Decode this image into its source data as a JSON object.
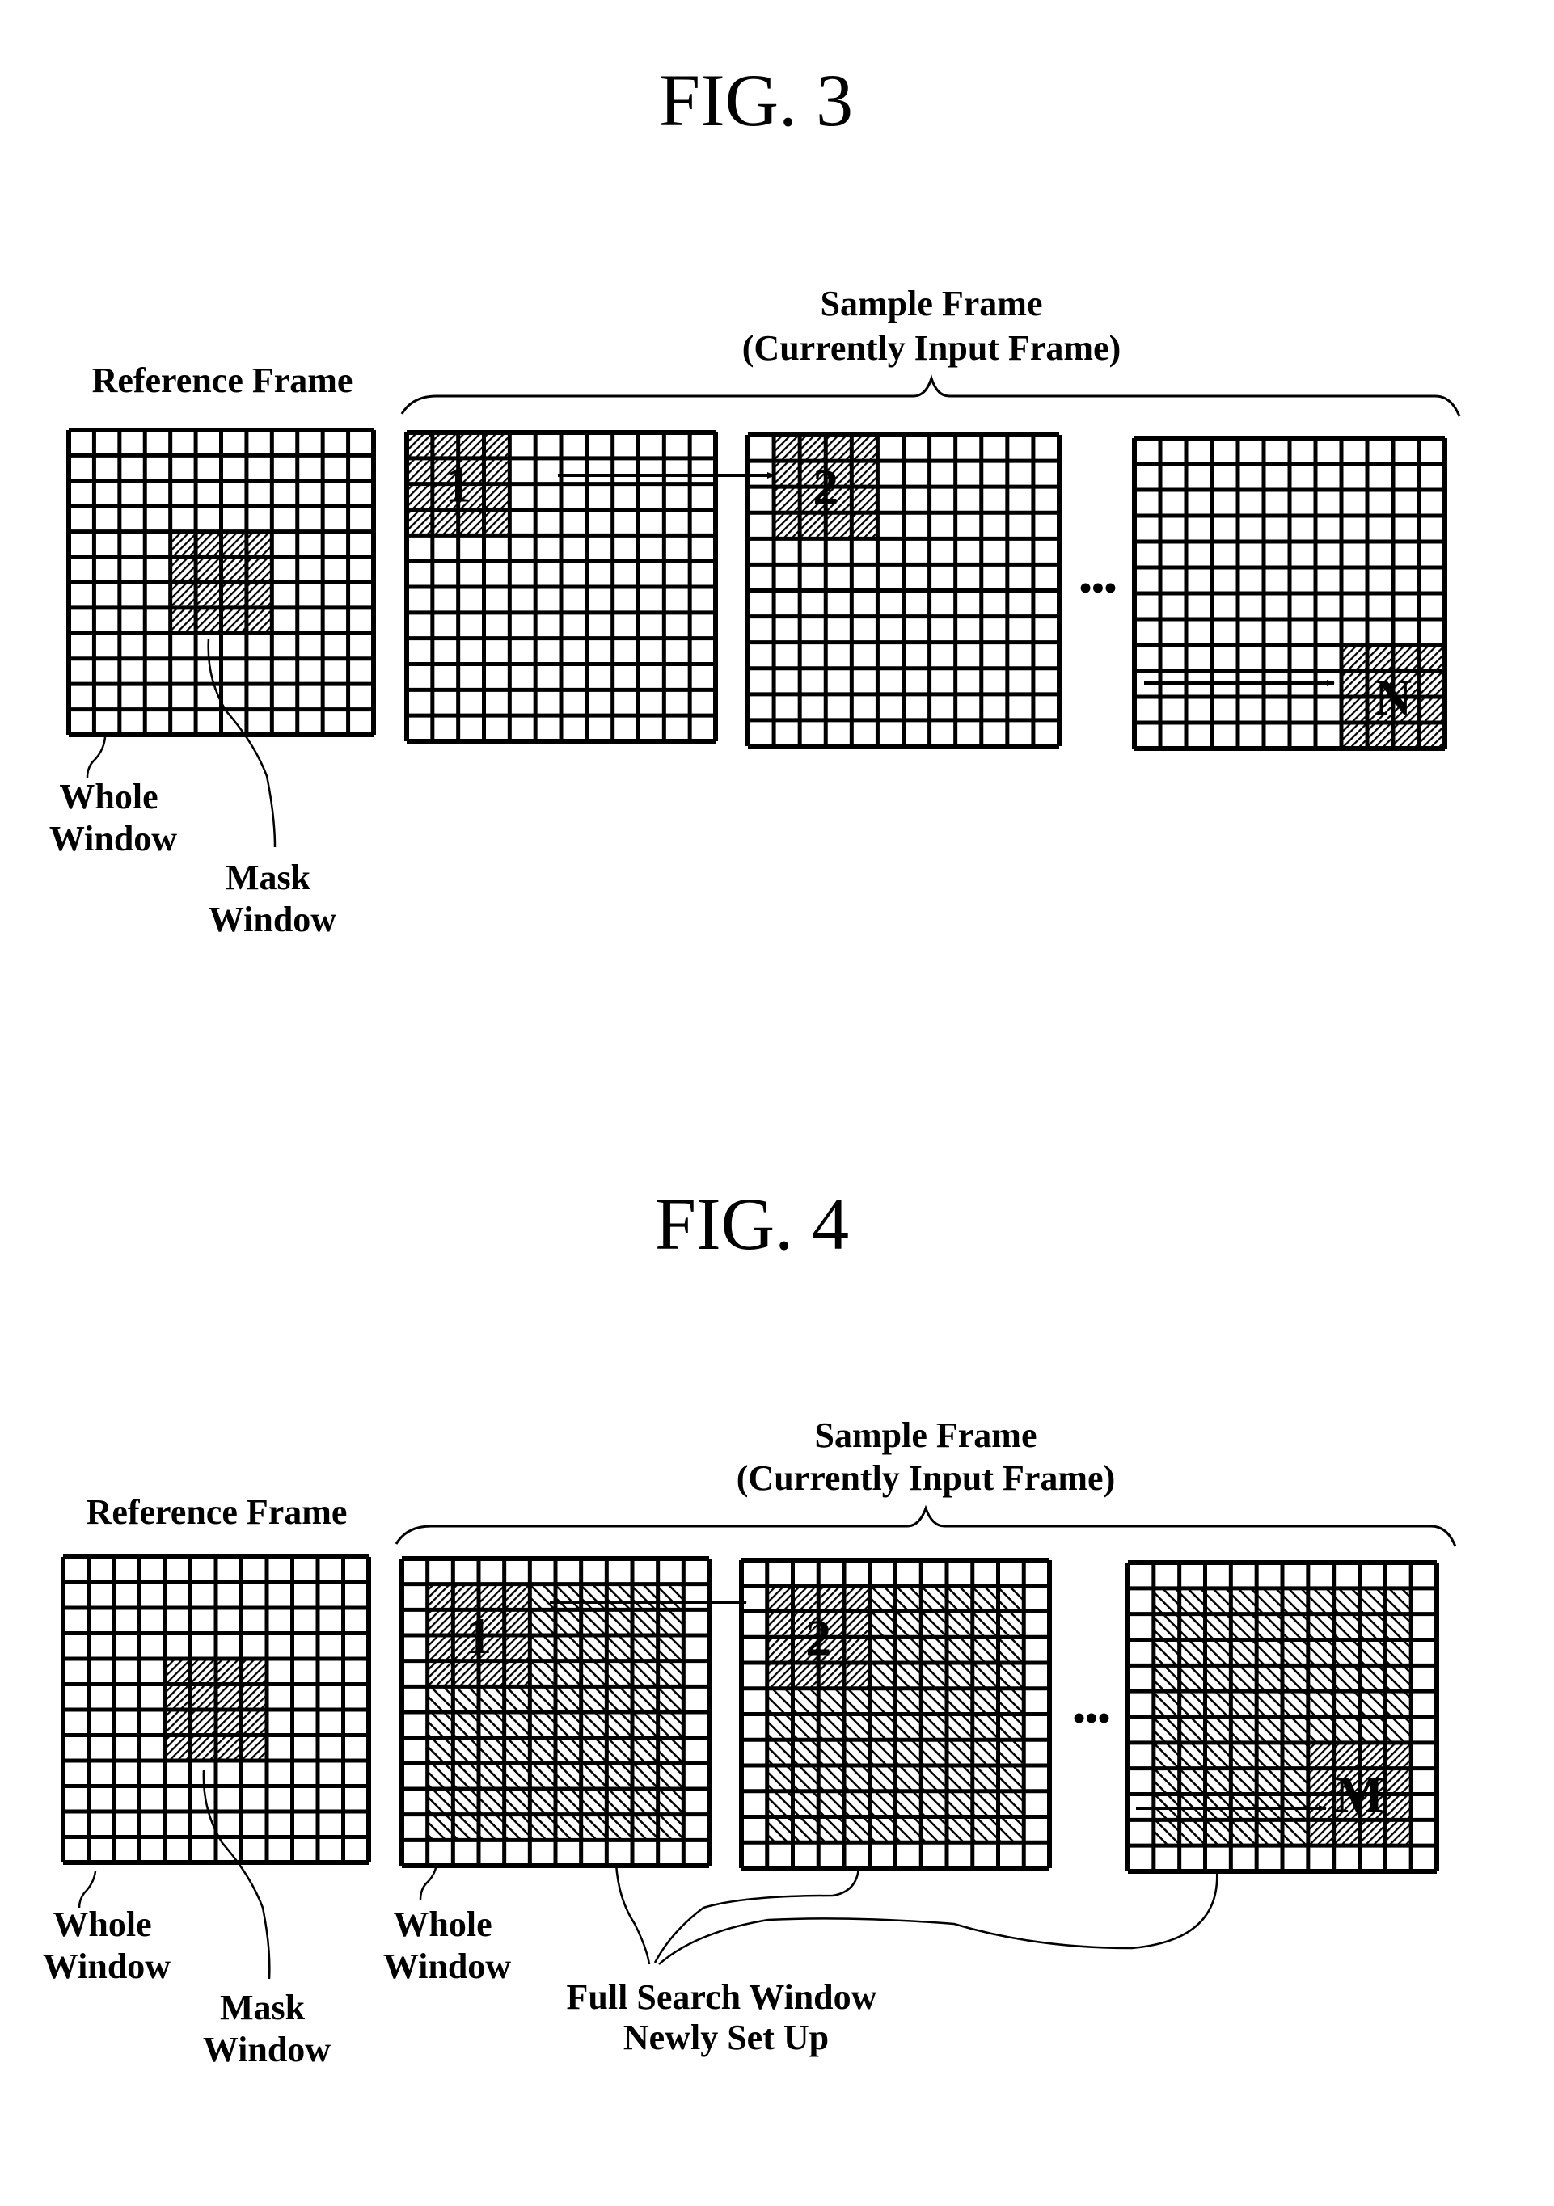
{
  "figures": [
    {
      "id": "fig3",
      "title": "FIG. 3",
      "reference_frame": {
        "label": "Reference Frame",
        "grid_size": 12,
        "mask_window": {
          "row": 4,
          "col": 4,
          "size": 4
        },
        "callouts": {
          "whole_window": [
            "Whole",
            "Window"
          ],
          "mask_window": [
            "Mask",
            "Window"
          ]
        }
      },
      "sample_frame": {
        "label_line1": "Sample Frame",
        "label_line2": "(Currently Input Frame)",
        "ellipsis": "•••",
        "frames": [
          {
            "index_label": "1",
            "grid_size": 12,
            "mask": {
              "row": 0,
              "col": 0,
              "size": 4
            },
            "search_window": null
          },
          {
            "index_label": "2",
            "grid_size": 12,
            "mask": {
              "row": 0,
              "col": 1,
              "size": 4
            },
            "search_window": null
          },
          {
            "index_label": "N",
            "grid_size": 12,
            "mask": {
              "row": 8,
              "col": 8,
              "size": 4
            },
            "search_window": null
          }
        ]
      }
    },
    {
      "id": "fig4",
      "title": "FIG. 4",
      "reference_frame": {
        "label": "Reference Frame",
        "grid_size": 12,
        "mask_window": {
          "row": 4,
          "col": 4,
          "size": 4
        },
        "callouts": {
          "whole_window": [
            "Whole",
            "Window"
          ],
          "mask_window": [
            "Mask",
            "Window"
          ]
        }
      },
      "sample_frame": {
        "label_line1": "Sample Frame",
        "label_line2": "(Currently Input Frame)",
        "ellipsis": "•••",
        "frames": [
          {
            "index_label": "1",
            "grid_size": 12,
            "mask": {
              "row": 1,
              "col": 1,
              "size": 4
            },
            "search_window": {
              "row": 1,
              "col": 1,
              "size": 10
            }
          },
          {
            "index_label": "2",
            "grid_size": 12,
            "mask": {
              "row": 1,
              "col": 1,
              "size": 4
            },
            "search_window": {
              "row": 1,
              "col": 1,
              "size": 10
            }
          },
          {
            "index_label": "M",
            "grid_size": 12,
            "mask": {
              "row": 7,
              "col": 7,
              "size": 4
            },
            "search_window": {
              "row": 1,
              "col": 1,
              "size": 10
            }
          }
        ],
        "callouts": {
          "whole_window": [
            "Whole",
            "Window"
          ],
          "full_search_window": [
            "Full Search Window",
            "Newly Set Up"
          ]
        }
      }
    }
  ]
}
